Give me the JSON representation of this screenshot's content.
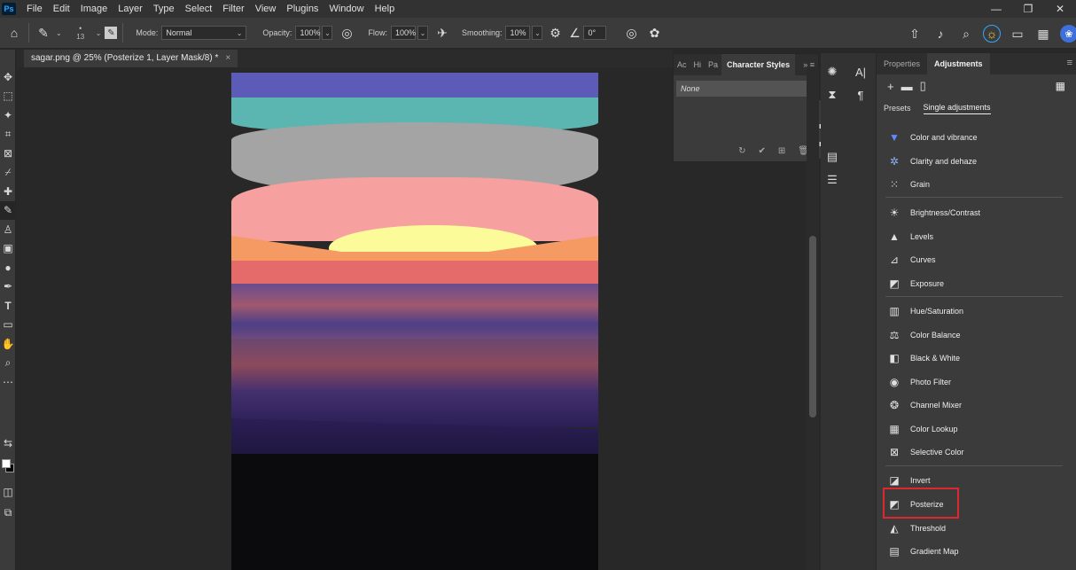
{
  "app": {
    "logo": "Ps"
  },
  "menu": [
    "File",
    "Edit",
    "Image",
    "Layer",
    "Type",
    "Select",
    "Filter",
    "View",
    "Plugins",
    "Window",
    "Help"
  ],
  "window_controls": [
    "—",
    "❐",
    "✕"
  ],
  "options": {
    "brush_size": "13",
    "mode_label": "Mode:",
    "mode_value": "Normal",
    "opacity_label": "Opacity:",
    "opacity_value": "100%",
    "flow_label": "Flow:",
    "flow_value": "100%",
    "smoothing_label": "Smoothing:",
    "smoothing_value": "10%",
    "angle_value": "0°"
  },
  "document": {
    "tab_title": "sagar.png @ 25% (Posterize 1, Layer Mask/8) *",
    "close": "×"
  },
  "char_panel": {
    "tabs": [
      "Ac",
      "Hi",
      "Pa",
      "Character Styles"
    ],
    "none_label": "None"
  },
  "mini_popup": {
    "line1": "rs",
    "line2": "nnels"
  },
  "right_panel": {
    "tabs": [
      "Properties",
      "Adjustments"
    ],
    "subtabs": [
      "Presets",
      "Single adjustments"
    ],
    "groups": [
      [
        "Color and vibrance",
        "Clarity and dehaze",
        "Grain"
      ],
      [
        "Brightness/Contrast",
        "Levels",
        "Curves",
        "Exposure"
      ],
      [
        "Hue/Saturation",
        "Color Balance",
        "Black & White",
        "Photo Filter",
        "Channel Mixer",
        "Color Lookup",
        "Selective Color"
      ],
      [
        "Invert",
        "Posterize",
        "Threshold",
        "Gradient Map"
      ]
    ]
  },
  "colors": {
    "highlight": "#e0262f",
    "accent_ps": "#31a8ff"
  }
}
